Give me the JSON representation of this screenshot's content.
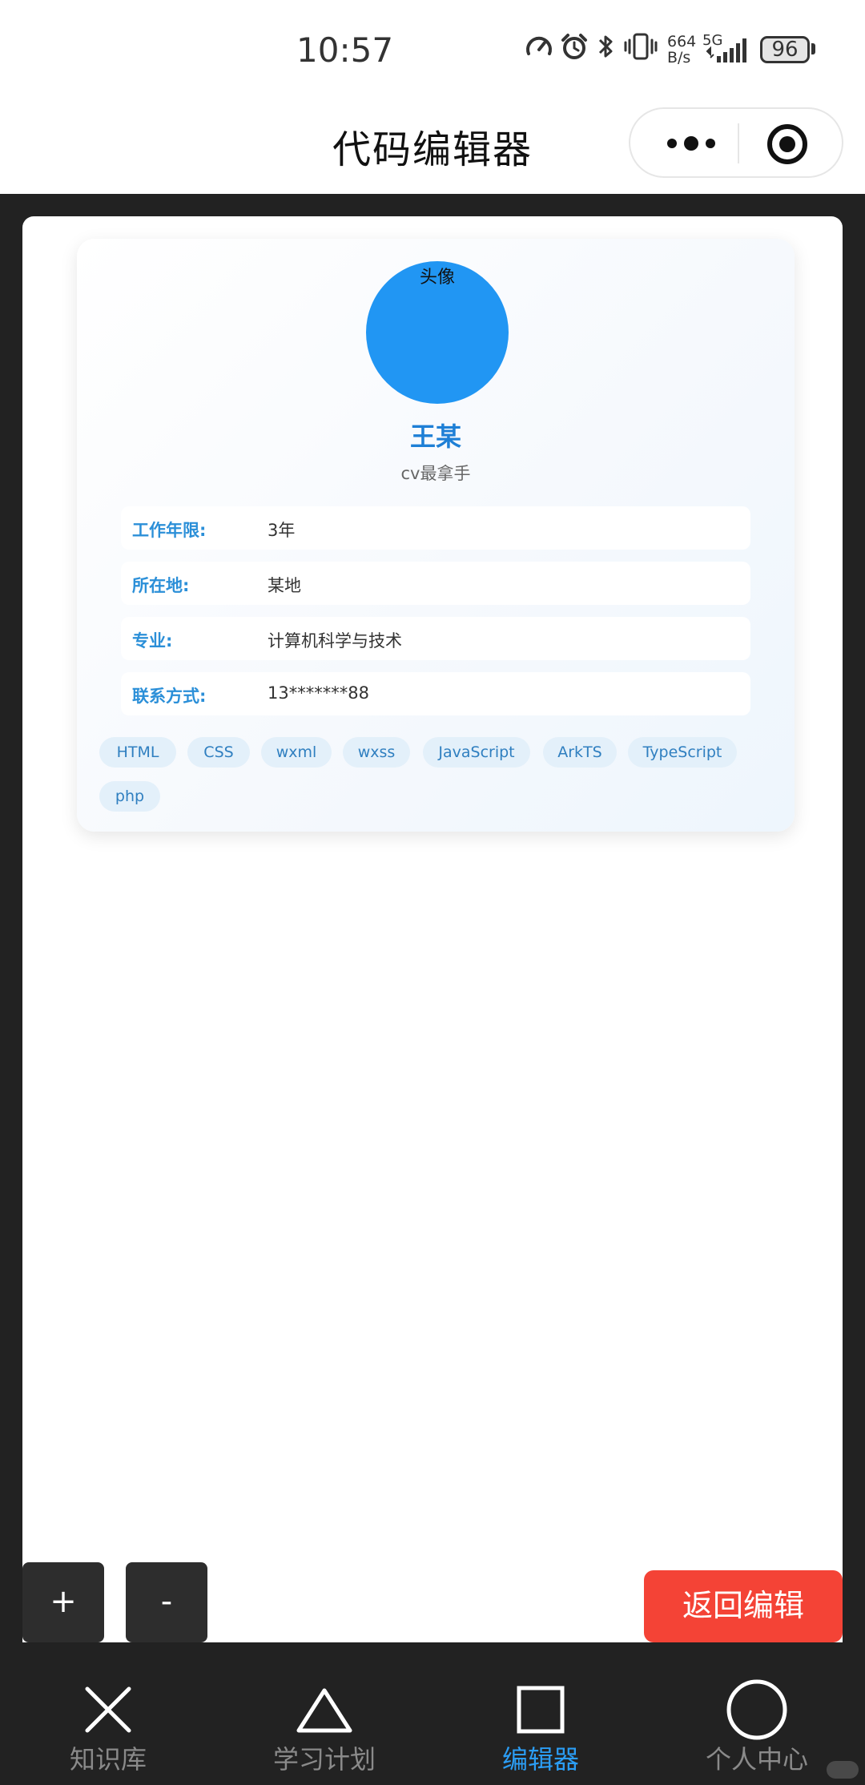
{
  "status_bar": {
    "time": "10:57",
    "net_speed_value": "664",
    "net_speed_unit": "B/s",
    "network_type": "5G",
    "battery": "96",
    "icons": [
      "speedometer-icon",
      "alarm-icon",
      "bluetooth-icon",
      "vibrate-icon",
      "signal-icon",
      "battery-icon"
    ]
  },
  "nav": {
    "title": "代码编辑器",
    "more_icon": "more-dots-icon",
    "close_icon": "target-icon"
  },
  "profile": {
    "avatar_alt": "头像",
    "avatar_color": "#2196f3",
    "name": "王某",
    "subtitle": "cv最拿手",
    "info": [
      {
        "label": "工作年限:",
        "value": "3年"
      },
      {
        "label": "所在地:",
        "value": "某地"
      },
      {
        "label": "专业:",
        "value": "计算机科学与技术"
      },
      {
        "label": "联系方式:",
        "value": "13*******88"
      }
    ],
    "tags": [
      "HTML",
      "CSS",
      "wxml",
      "wxss",
      "JavaScript",
      "ArkTS",
      "TypeScript",
      "php"
    ]
  },
  "controls": {
    "zoom_in": "+",
    "zoom_out": "-",
    "return_label": "返回编辑",
    "return_color": "#f44336"
  },
  "tabbar": {
    "items": [
      {
        "label": "知识库",
        "icon": "close-x-icon"
      },
      {
        "label": "学习计划",
        "icon": "triangle-icon"
      },
      {
        "label": "编辑器",
        "icon": "square-icon"
      },
      {
        "label": "个人中心",
        "icon": "circle-icon"
      }
    ],
    "active_index": 2,
    "active_color": "#2b9df4"
  }
}
